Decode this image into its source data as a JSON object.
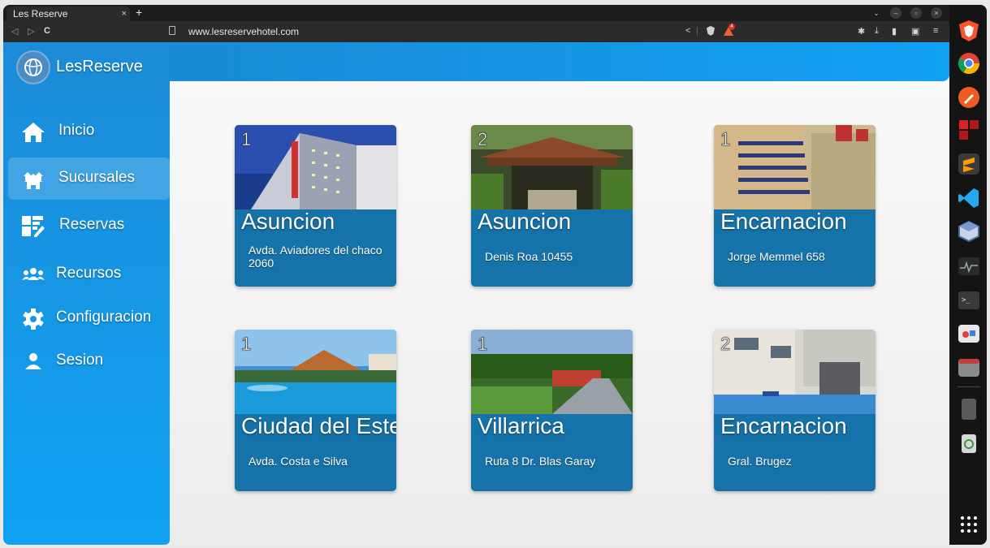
{
  "browser": {
    "tab_title": "Les Reserve",
    "tab_close": "×",
    "new_tab": "+",
    "url": "www.lesreservehotel.com",
    "brave_badge": "4"
  },
  "app": {
    "brand": "LesReserve",
    "accent_top": "#1c86cf",
    "card_color": "#1673a9"
  },
  "sidebar": {
    "items": [
      {
        "label": "Inicio",
        "icon": "home-icon"
      },
      {
        "label": "Sucursales",
        "icon": "branches-icon",
        "active": true
      },
      {
        "label": "Reservas",
        "icon": "reservations-icon"
      },
      {
        "label": "Recursos",
        "icon": "people-icon"
      },
      {
        "label": "Configuracion",
        "icon": "gear-icon"
      },
      {
        "label": "Sesion",
        "icon": "user-icon"
      }
    ]
  },
  "branches": [
    {
      "number": "1",
      "city": "Asuncion",
      "address": "Avda. Aviadores del chaco 2060"
    },
    {
      "number": "2",
      "city": "Asuncion",
      "address": "Denis Roa 10455"
    },
    {
      "number": "1",
      "city": "Encarnacion",
      "address": "Jorge Memmel 658"
    },
    {
      "number": "1",
      "city": "Ciudad del Este",
      "address": "Avda. Costa e Silva"
    },
    {
      "number": "1",
      "city": "Villarrica",
      "address": "Ruta 8 Dr. Blas Garay"
    },
    {
      "number": "2",
      "city": "Encarnacion",
      "address": "Gral. Brugez"
    }
  ]
}
